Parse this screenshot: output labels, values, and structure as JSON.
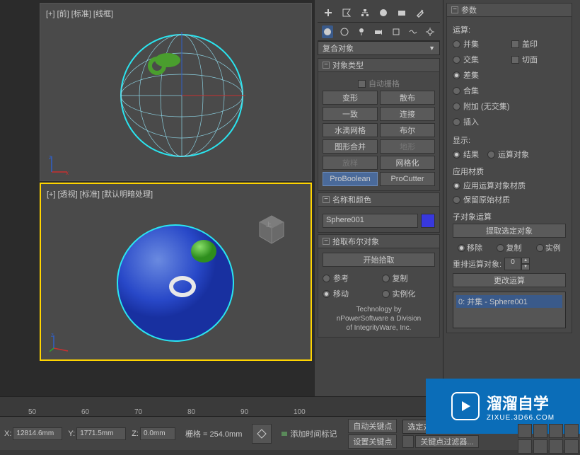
{
  "viewports": {
    "top_label": "[+] [前] [标准] [线框]",
    "bottom_label": "[+] [透视] [标准] [默认明暗处理]"
  },
  "dropdown_compound": "复合对象",
  "rollouts": {
    "object_type": {
      "title": "对象类型",
      "autogrid": "自动栅格",
      "buttons": [
        "变形",
        "散布",
        "一致",
        "连接",
        "水滴网格",
        "布尔",
        "图形合并",
        "地形",
        "放样",
        "网格化",
        "ProBoolean",
        "ProCutter"
      ]
    },
    "name_color": {
      "title": "名称和颜色",
      "name": "Sphere001"
    },
    "pick_boolean": {
      "title": "拾取布尔对象",
      "start_pick": "开始拾取",
      "ref": "参考",
      "copy": "复制",
      "move": "移动",
      "instance": "实例化",
      "credit": "Technology by\nnPowerSoftware a Division\nof IntegrityWare, Inc."
    },
    "parameters": {
      "title": "参数",
      "operation": "运算:",
      "ops": {
        "union": "并集",
        "imprint": "盖印",
        "intersect": "交集",
        "cookie": "切面",
        "subtract": "差集",
        "merge": "合集",
        "attach": "附加 (无交集)",
        "insert": "插入"
      },
      "display": "显示:",
      "result": "结果",
      "op_object": "运算对象",
      "apply_material": "应用材质",
      "apply_op_mat": "应用运算对象材质",
      "keep_orig_mat": "保留原始材质",
      "sub_obj_op": "子对象运算",
      "extract_selected": "提取选定对象",
      "remove": "移除",
      "copy2": "复制",
      "inst": "实例",
      "reorder_ops": "重排运算对象:",
      "spinner_val": "0",
      "change_op": "更改运算",
      "list_item": "0: 并集 - Sphere001"
    }
  },
  "ruler": {
    "ticks": [
      "50",
      "60",
      "70",
      "80",
      "90",
      "100"
    ]
  },
  "status": {
    "x_label": "X:",
    "x_val": "12814.6mm",
    "y_label": "Y:",
    "y_val": "1771.5mm",
    "z_label": "Z:",
    "z_val": "0.0mm",
    "grid": "栅格 = 254.0mm",
    "add_time_tag": "添加时间标记",
    "auto_key": "自动关键点",
    "selected": "选定对象",
    "set_key": "设置关键点",
    "key_filters": "关键点过滤器..."
  },
  "watermark": {
    "cn": "溜溜自学",
    "url": "ZIXUE.3D66.COM"
  }
}
